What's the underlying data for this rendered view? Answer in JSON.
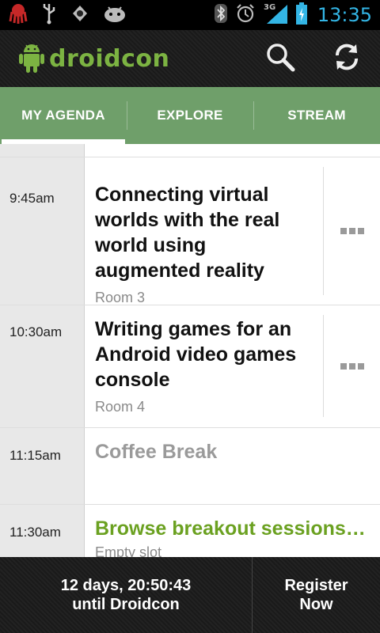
{
  "status_bar": {
    "left_icons": [
      "octocat-icon",
      "usb-icon",
      "app-notification-icon",
      "android-debug-icon"
    ],
    "right_icons": [
      "bluetooth-icon",
      "alarm-icon",
      "signal-3g-icon",
      "battery-charging-icon"
    ],
    "network": "3G",
    "time": "13:35",
    "accent": "#33b5e5"
  },
  "action_bar": {
    "app_name": "droidcon",
    "actions": [
      "search-icon",
      "refresh-icon"
    ],
    "brand_color": "#7cb342"
  },
  "tabs": [
    {
      "label": "MY AGENDA",
      "active": true
    },
    {
      "label": "EXPLORE",
      "active": false
    },
    {
      "label": "STREAM",
      "active": false
    }
  ],
  "tab_color": "#6f9f6a",
  "agenda": [
    {
      "time": "9:45am",
      "title": "Connecting virtual worlds with the real world using augmented reality",
      "room": "Room 3",
      "style": "session",
      "has_more": true
    },
    {
      "time": "10:30am",
      "title": "Writing games for an Android video games console",
      "room": "Room 4",
      "style": "session",
      "has_more": true
    },
    {
      "time": "11:15am",
      "title": "Coffee Break",
      "room": "",
      "style": "break",
      "has_more": false
    },
    {
      "time": "11:30am",
      "title": "Browse breakout sessions…",
      "room": "Empty slot",
      "style": "empty",
      "has_more": false
    }
  ],
  "bottom_bar": {
    "countdown_line1": "12 days, 20:50:43",
    "countdown_line2": "until Droidcon",
    "register_line1": "Register",
    "register_line2": "Now"
  }
}
